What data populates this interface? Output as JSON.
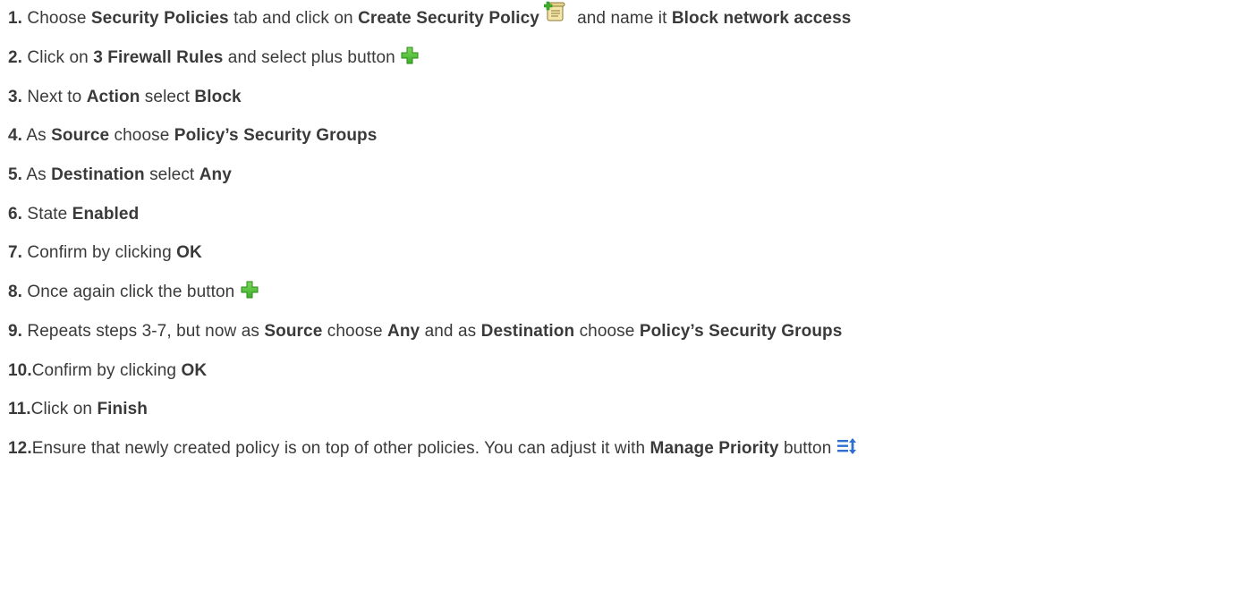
{
  "steps": [
    {
      "num": "1.",
      "parts": [
        {
          "t": " Choose "
        },
        {
          "t": "Security Policies",
          "b": true
        },
        {
          "t": " tab and click on "
        },
        {
          "t": "Create Security Policy",
          "b": true
        },
        {
          "t": " "
        },
        {
          "icon": "create-policy-icon"
        },
        {
          "t": "  and name it "
        },
        {
          "t": "Block network access",
          "b": true
        }
      ]
    },
    {
      "num": "2.",
      "parts": [
        {
          "t": " Click on "
        },
        {
          "t": "3 Firewall Rules",
          "b": true
        },
        {
          "t": " and select plus button "
        },
        {
          "icon": "plus-icon"
        }
      ]
    },
    {
      "num": "3.",
      "parts": [
        {
          "t": " Next to "
        },
        {
          "t": "Action",
          "b": true
        },
        {
          "t": " select "
        },
        {
          "t": "Block",
          "b": true
        }
      ]
    },
    {
      "num": "4.",
      "parts": [
        {
          "t": " As "
        },
        {
          "t": "Source",
          "b": true
        },
        {
          "t": " choose "
        },
        {
          "t": "Policy’s Security Groups",
          "b": true
        }
      ]
    },
    {
      "num": "5.",
      "parts": [
        {
          "t": " As "
        },
        {
          "t": "Destination",
          "b": true
        },
        {
          "t": " select "
        },
        {
          "t": "Any",
          "b": true
        }
      ]
    },
    {
      "num": "6.",
      "parts": [
        {
          "t": " State "
        },
        {
          "t": "Enabled",
          "b": true
        }
      ]
    },
    {
      "num": "7.",
      "parts": [
        {
          "t": " Confirm by clicking "
        },
        {
          "t": "OK",
          "b": true
        }
      ]
    },
    {
      "num": "8.",
      "parts": [
        {
          "t": " Once again click the button "
        },
        {
          "icon": "plus-icon"
        }
      ]
    },
    {
      "num": "9.",
      "parts": [
        {
          "t": " Repeats steps 3-7, but now as "
        },
        {
          "t": "Source",
          "b": true
        },
        {
          "t": " choose "
        },
        {
          "t": "Any",
          "b": true
        },
        {
          "t": " and as "
        },
        {
          "t": "Destination",
          "b": true
        },
        {
          "t": " choose "
        },
        {
          "t": "Policy’s Security Groups",
          "b": true
        }
      ]
    },
    {
      "num": "10.",
      "parts": [
        {
          "t": "Confirm by clicking "
        },
        {
          "t": "OK",
          "b": true
        }
      ]
    },
    {
      "num": "11.",
      "parts": [
        {
          "t": "Click on "
        },
        {
          "t": "Finish",
          "b": true
        }
      ]
    },
    {
      "num": "12.",
      "parts": [
        {
          "t": "Ensure that newly created policy is on top of other policies. You can adjust it with "
        },
        {
          "t": "Manage Priority",
          "b": true
        },
        {
          "t": " button "
        },
        {
          "icon": "manage-priority-icon"
        }
      ]
    }
  ],
  "colors": {
    "text": "#3a3a3a",
    "plus_green": "#3fae2a",
    "priority_blue": "#2e6fd0"
  }
}
